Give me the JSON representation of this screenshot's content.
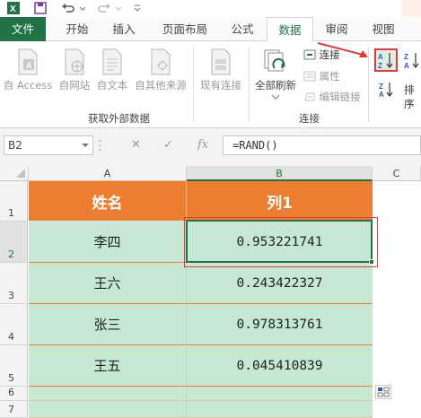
{
  "tabs": [
    "文件",
    "开始",
    "插入",
    "页面布局",
    "公式",
    "数据",
    "审阅",
    "视图"
  ],
  "ribbon": {
    "get_external": {
      "buttons": [
        "自 Access",
        "自网站",
        "自文本",
        "自其他来源",
        "现有连接"
      ],
      "group_label": "获取外部数据"
    },
    "connections": {
      "refresh_all": "全部刷新",
      "items": [
        "连接",
        "属性",
        "编辑链接"
      ],
      "group_label": "连接"
    },
    "sort": {
      "sort_label": "排序"
    }
  },
  "formula_bar": {
    "name_box": "B2",
    "fx": "fx",
    "formula": "=RAND()"
  },
  "grid": {
    "columns": [
      "A",
      "B",
      "C"
    ],
    "rows": [
      "1",
      "2",
      "3",
      "4",
      "5",
      "6",
      "7"
    ],
    "headers": [
      "姓名",
      "列1"
    ],
    "data": [
      {
        "name": "李四",
        "value": "0.953221741"
      },
      {
        "name": "王六",
        "value": "0.243422327"
      },
      {
        "name": "张三",
        "value": "0.978313761"
      },
      {
        "name": "王五",
        "value": "0.045410839"
      }
    ]
  },
  "colors": {
    "accent": "#217346",
    "header_fill": "#ed7d31",
    "data_fill": "#c6e8d3",
    "highlight": "#e53935"
  }
}
